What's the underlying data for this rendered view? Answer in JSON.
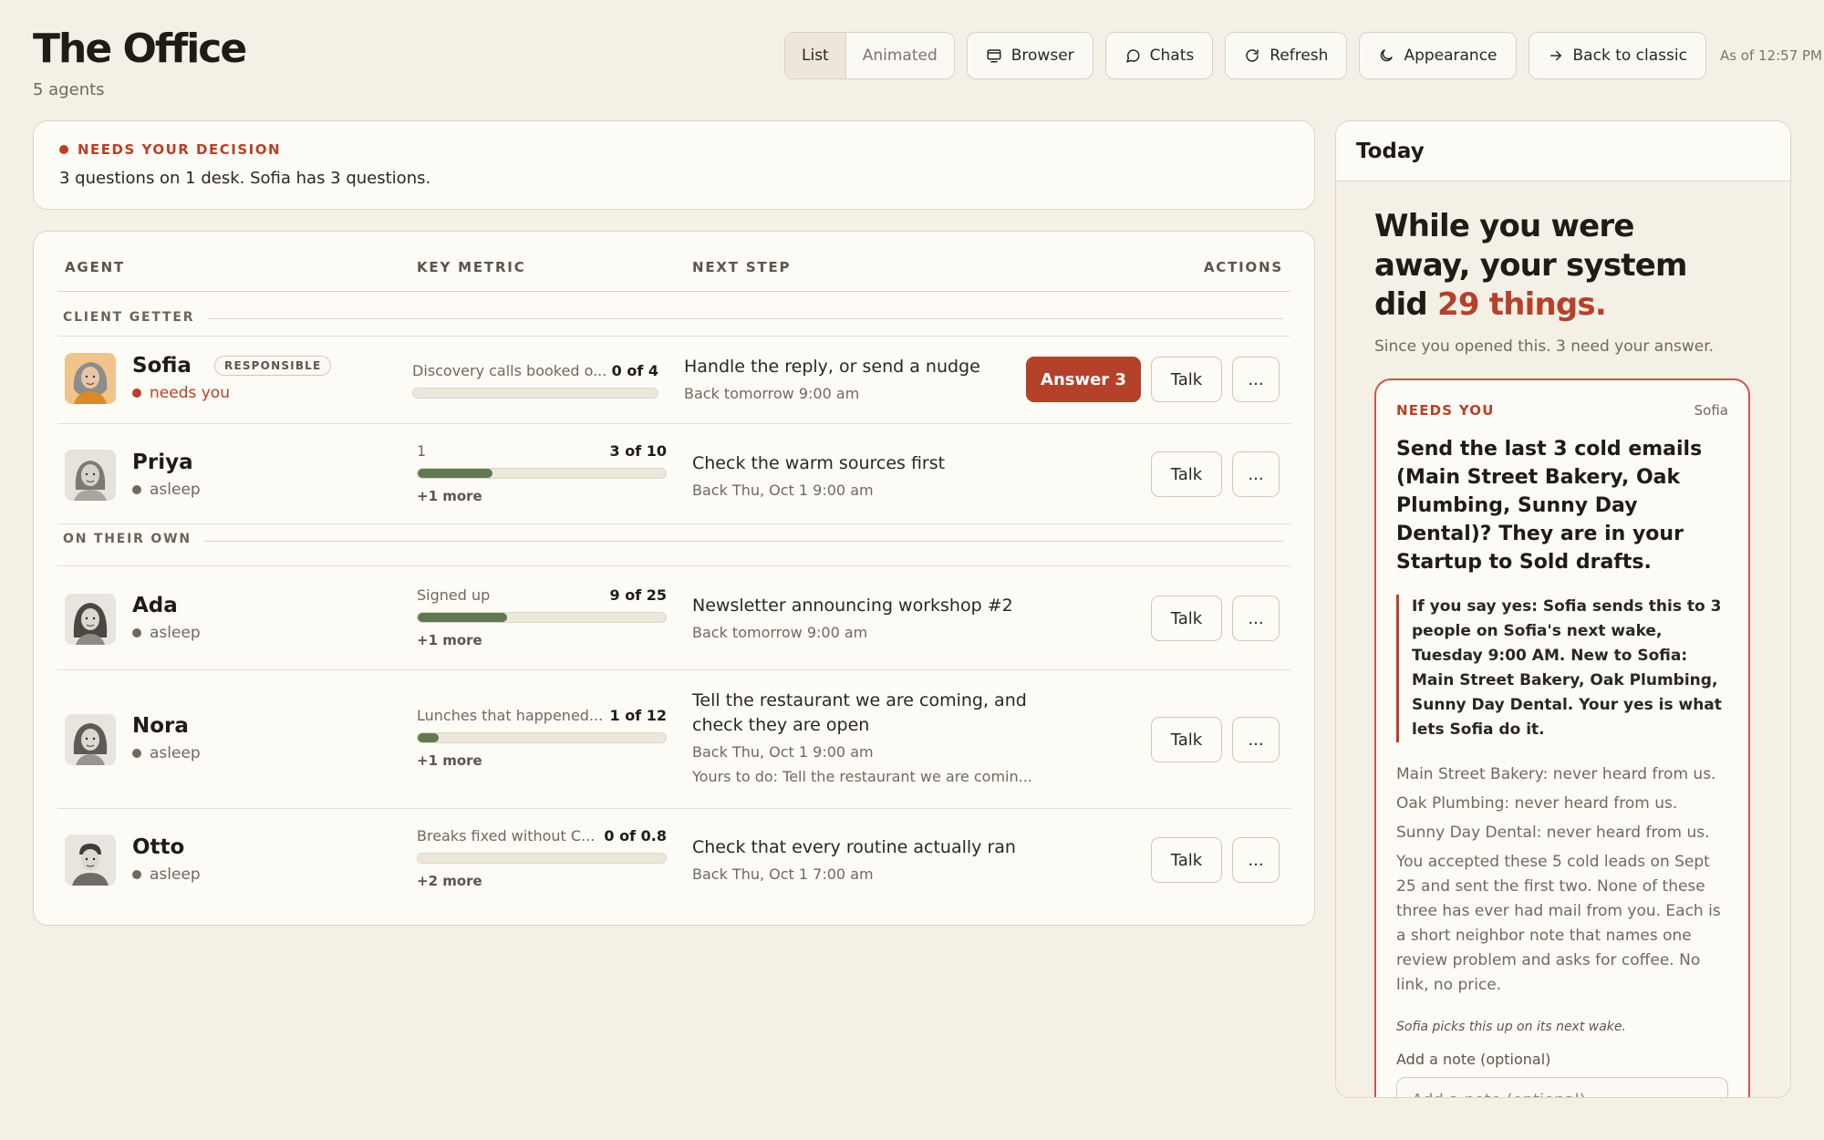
{
  "header": {
    "title": "The Office",
    "subtitle": "5 agents"
  },
  "toolbar": {
    "view_list": "List",
    "view_animated": "Animated",
    "browser": "Browser",
    "chats": "Chats",
    "refresh": "Refresh",
    "appearance": "Appearance",
    "back": "Back to classic",
    "as_of": "As of 12:57 PM"
  },
  "decision": {
    "label": "NEEDS YOUR DECISION",
    "text": "3 questions on 1 desk. Sofia has 3 questions."
  },
  "table": {
    "headers": {
      "agent": "AGENT",
      "metric": "KEY METRIC",
      "next": "NEXT STEP",
      "actions": "ACTIONS"
    },
    "groups": {
      "client_getter": "CLIENT GETTER",
      "on_their_own": "ON THEIR OWN"
    },
    "rows": [
      {
        "name": "Sofia",
        "badge": "RESPONSIBLE",
        "status": "needs you",
        "metric_label": "Discovery calls booked o...",
        "metric_value": "0 of 4",
        "progress": 0,
        "next_title": "Handle the reply, or send a nudge",
        "next_sub": "Back tomorrow 9:00 am",
        "primary": "Answer 3",
        "talk": "Talk",
        "more_btn": "..."
      },
      {
        "name": "Priya",
        "status": "asleep",
        "metric_label": "1",
        "metric_value": "3 of 10",
        "progress": 0.3,
        "more": "+1 more",
        "next_title": "Check the warm sources first",
        "next_sub": "Back Thu, Oct 1 9:00 am",
        "talk": "Talk",
        "more_btn": "..."
      },
      {
        "name": "Ada",
        "status": "asleep",
        "metric_label": "Signed up",
        "metric_value": "9 of 25",
        "progress": 0.36,
        "more": "+1 more",
        "next_title": "Newsletter announcing workshop #2",
        "next_sub": "Back tomorrow 9:00 am",
        "talk": "Talk",
        "more_btn": "..."
      },
      {
        "name": "Nora",
        "status": "asleep",
        "metric_label": "Lunches that happened...",
        "metric_value": "1 of 12",
        "progress": 0.083,
        "more": "+1 more",
        "next_title_1": "Tell the restaurant we are coming, and",
        "next_title_2": "check they are open",
        "next_sub": "Back Thu, Oct 1 9:00 am",
        "next_extra": "Yours to do: Tell the restaurant we are comin...",
        "talk": "Talk",
        "more_btn": "..."
      },
      {
        "name": "Otto",
        "status": "asleep",
        "metric_label": "Breaks fixed without C...",
        "metric_value": "0 of 0.8",
        "progress": 0,
        "more": "+2 more",
        "next_title": "Check that every routine actually ran",
        "next_sub": "Back Thu, Oct 1 7:00 am",
        "talk": "Talk",
        "more_btn": "..."
      }
    ]
  },
  "today": {
    "title": "Today",
    "headline_1": "While you were",
    "headline_2": "away, your system",
    "headline_3": "did",
    "headline_accent": "29 things.",
    "since": "Since you opened this. 3 need your answer.",
    "card": {
      "label": "NEEDS YOU",
      "who": "Sofia",
      "question": "Send the last 3 cold emails (Main Street Bakery, Oak Plumbing, Sunny Day Dental)? They are in your Startup to Sold drafts.",
      "quote": "If you say yes: Sofia sends this to 3 people on Sofia's next wake, Tuesday 9:00 AM. New to Sofia: Main Street Bakery, Oak Plumbing, Sunny Day Dental. Your yes is what lets Sofia do it.",
      "facts": [
        "Main Street Bakery: never heard from us.",
        "Oak Plumbing: never heard from us.",
        "Sunny Day Dental: never heard from us.",
        "You accepted these 5 cold leads on Sept 25 and sent the first two. None of these three has ever had mail from you. Each is a short neighbor note that names one review problem and asks for coffee. No link, no price."
      ],
      "pickup": "Sofia picks this up on its next wake.",
      "note_label": "Add a note (optional)",
      "note_placeholder": "Add a note (optional)"
    }
  }
}
